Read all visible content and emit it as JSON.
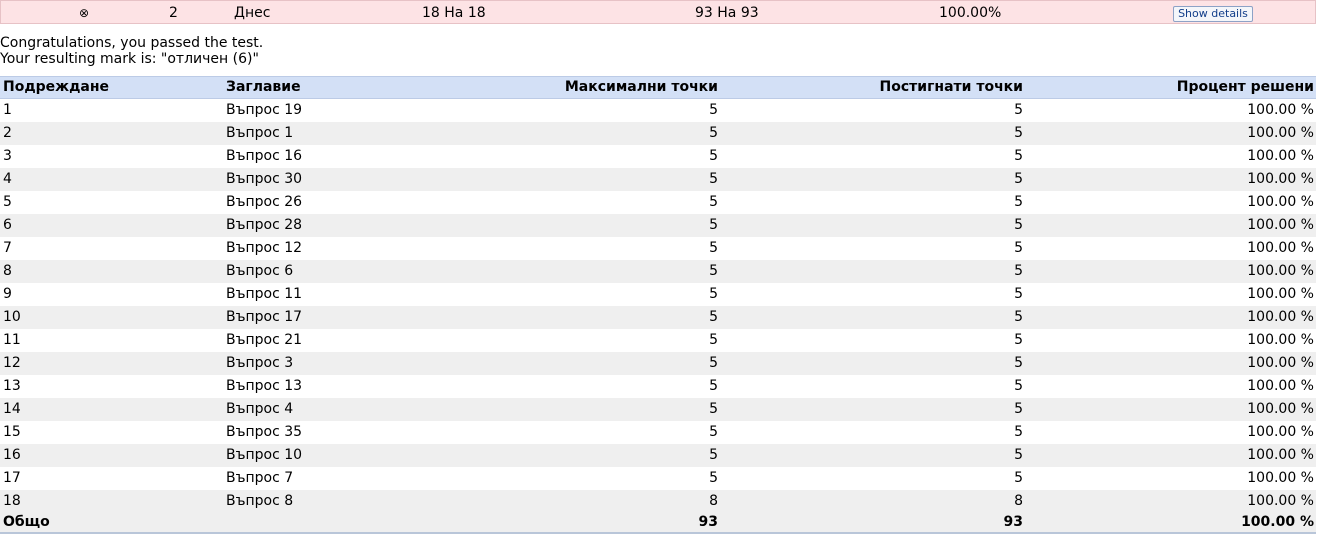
{
  "attempt": {
    "status_icon": "⊗",
    "number": "2",
    "date": "Днес",
    "questions": "18 На 18",
    "score": "93 На 93",
    "percent": "100.00%",
    "details_label": "Show details"
  },
  "message": {
    "line1": "Congratulations, you passed the test.",
    "line2": "Your resulting mark is: \"отличен (6)\""
  },
  "table": {
    "headers": {
      "order": "Подреждане",
      "title": "Заглавие",
      "max_points": "Максимални точки",
      "earned_points": "Постигнати точки",
      "percent": "Процент решени"
    },
    "rows": [
      {
        "order": "1",
        "title": "Въпрос 19",
        "max": "5",
        "earned": "5",
        "percent": "100.00 %"
      },
      {
        "order": "2",
        "title": "Въпрос 1",
        "max": "5",
        "earned": "5",
        "percent": "100.00 %"
      },
      {
        "order": "3",
        "title": "Въпрос 16",
        "max": "5",
        "earned": "5",
        "percent": "100.00 %"
      },
      {
        "order": "4",
        "title": "Въпрос 30",
        "max": "5",
        "earned": "5",
        "percent": "100.00 %"
      },
      {
        "order": "5",
        "title": "Въпрос 26",
        "max": "5",
        "earned": "5",
        "percent": "100.00 %"
      },
      {
        "order": "6",
        "title": "Въпрос 28",
        "max": "5",
        "earned": "5",
        "percent": "100.00 %"
      },
      {
        "order": "7",
        "title": "Въпрос 12",
        "max": "5",
        "earned": "5",
        "percent": "100.00 %"
      },
      {
        "order": "8",
        "title": "Въпрос 6",
        "max": "5",
        "earned": "5",
        "percent": "100.00 %"
      },
      {
        "order": "9",
        "title": "Въпрос 11",
        "max": "5",
        "earned": "5",
        "percent": "100.00 %"
      },
      {
        "order": "10",
        "title": "Въпрос 17",
        "max": "5",
        "earned": "5",
        "percent": "100.00 %"
      },
      {
        "order": "11",
        "title": "Въпрос 21",
        "max": "5",
        "earned": "5",
        "percent": "100.00 %"
      },
      {
        "order": "12",
        "title": "Въпрос 3",
        "max": "5",
        "earned": "5",
        "percent": "100.00 %"
      },
      {
        "order": "13",
        "title": "Въпрос 13",
        "max": "5",
        "earned": "5",
        "percent": "100.00 %"
      },
      {
        "order": "14",
        "title": "Въпрос 4",
        "max": "5",
        "earned": "5",
        "percent": "100.00 %"
      },
      {
        "order": "15",
        "title": "Въпрос 35",
        "max": "5",
        "earned": "5",
        "percent": "100.00 %"
      },
      {
        "order": "16",
        "title": "Въпрос 10",
        "max": "5",
        "earned": "5",
        "percent": "100.00 %"
      },
      {
        "order": "17",
        "title": "Въпрос 7",
        "max": "5",
        "earned": "5",
        "percent": "100.00 %"
      },
      {
        "order": "18",
        "title": "Въпрос 8",
        "max": "8",
        "earned": "8",
        "percent": "100.00 %"
      }
    ],
    "total": {
      "label": "Общо",
      "max": "93",
      "earned": "93",
      "percent": "100.00 %"
    }
  },
  "colors": {
    "attempt_row_bg": "#fde3e5",
    "header_bg": "#d3e0f6",
    "stripe_bg": "#efefef"
  }
}
